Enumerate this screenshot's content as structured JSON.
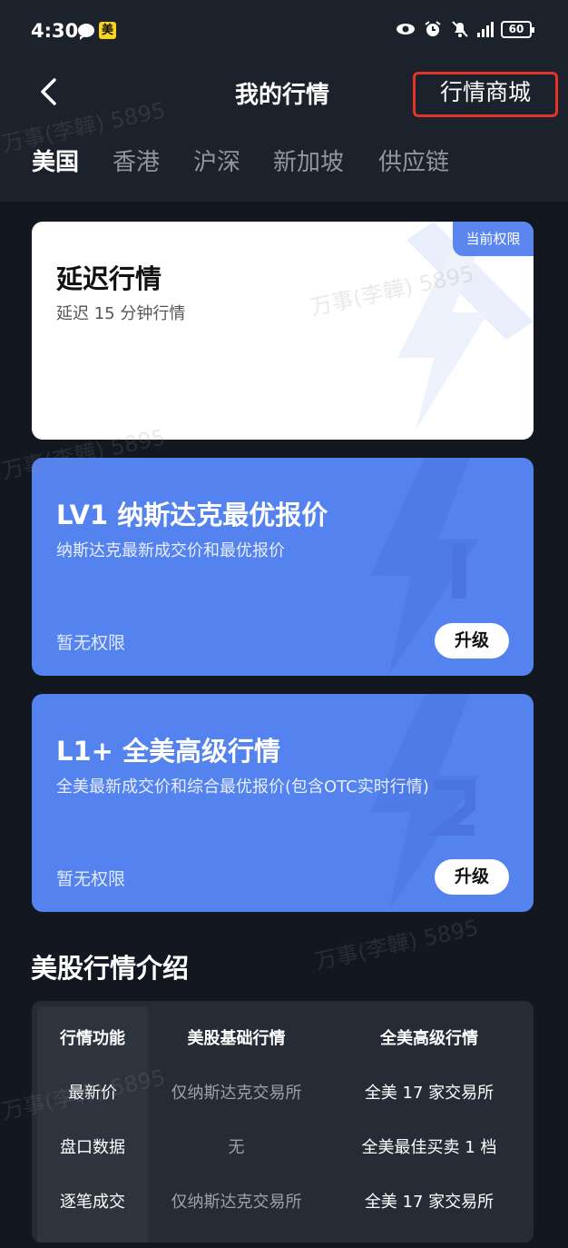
{
  "status_bar": {
    "time": "4:30",
    "meituan_badge": "美",
    "battery": "60",
    "icons": [
      "chat-icon",
      "meituan-icon",
      "eye-icon",
      "alarm-icon",
      "mute-icon",
      "signal-icon",
      "battery-icon"
    ]
  },
  "nav": {
    "back_icon": "chevron-left-icon",
    "title": "我的行情",
    "store_link": "行情商城",
    "highlight_color": "#e5332a"
  },
  "tabs": [
    {
      "label": "美国",
      "active": true
    },
    {
      "label": "香港",
      "active": false
    },
    {
      "label": "沪深",
      "active": false
    },
    {
      "label": "新加坡",
      "active": false
    },
    {
      "label": "供应链",
      "active": false
    }
  ],
  "cards": [
    {
      "title": "延迟行情",
      "subtitle": "延迟 15 分钟行情",
      "badge": "当前权限",
      "status": "",
      "button": ""
    },
    {
      "title": "LV1 纳斯达克最优报价",
      "subtitle": "纳斯达克最新成交价和最优报价",
      "status": "暂无权限",
      "button": "升级"
    },
    {
      "title": "L1+ 全美高级行情",
      "subtitle": "全美最新成交价和综合最优报价(包含OTC实时行情)",
      "status": "暂无权限",
      "button": "升级"
    }
  ],
  "intro": {
    "title": "美股行情介绍",
    "table": {
      "headers": [
        "行情功能",
        "美股基础行情",
        "全美高级行情"
      ],
      "rows": [
        [
          "最新价",
          "仅纳斯达克交易所",
          "全美 17 家交易所"
        ],
        [
          "盘口数据",
          "无",
          "全美最佳买卖 1 档"
        ],
        [
          "逐笔成交",
          "仅纳斯达克交易所",
          "全美 17 家交易所"
        ]
      ]
    }
  },
  "watermark": "万事(李韡) 5895",
  "colors": {
    "background": "#131820",
    "header_bg": "#1c222b",
    "card_blue": "#5483ef",
    "badge_blue": "#5b86f0"
  }
}
